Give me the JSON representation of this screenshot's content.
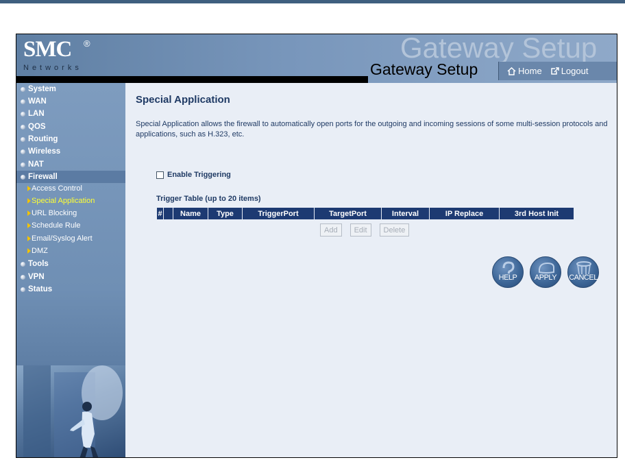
{
  "header": {
    "logo_brand": "SMC",
    "logo_reg": "®",
    "logo_sub": "Networks",
    "watermark": "Gateway Setup",
    "title": "Gateway Setup",
    "home_label": "Home",
    "logout_label": "Logout"
  },
  "sidebar": {
    "items": [
      {
        "label": "System"
      },
      {
        "label": "WAN"
      },
      {
        "label": "LAN"
      },
      {
        "label": "QOS"
      },
      {
        "label": "Routing"
      },
      {
        "label": "Wireless"
      },
      {
        "label": "NAT"
      },
      {
        "label": "Firewall",
        "active": true
      },
      {
        "label": "Tools"
      },
      {
        "label": "VPN"
      },
      {
        "label": "Status"
      }
    ],
    "firewall_sub": [
      {
        "label": "Access Control"
      },
      {
        "label": "Special Application",
        "active": true
      },
      {
        "label": "URL Blocking"
      },
      {
        "label": "Schedule Rule"
      },
      {
        "label": "Email/Syslog Alert"
      },
      {
        "label": "DMZ"
      }
    ]
  },
  "main": {
    "title": "Special Application",
    "description": "Special Application allows the firewall to automatically open ports for the outgoing and incoming sessions of some multi-session protocols and applications, such as H.323, etc.",
    "enable_label": "Enable Triggering",
    "enable_checked": false,
    "table_caption": "Trigger Table (up to 20 items)",
    "columns": [
      "#",
      "Name",
      "Type",
      "TriggerPort",
      "TargetPort",
      "Interval",
      "IP Replace",
      "3rd Host Init"
    ],
    "buttons": {
      "add": "Add",
      "edit": "Edit",
      "delete": "Delete"
    },
    "actions": {
      "help": "HELP",
      "apply": "APPLY",
      "cancel": "CANCEL"
    }
  },
  "colors": {
    "header_blue": "#6a87ab",
    "table_header": "#1d3a72",
    "active_sub": "#ffff33",
    "content_bg": "#e9eef6"
  }
}
